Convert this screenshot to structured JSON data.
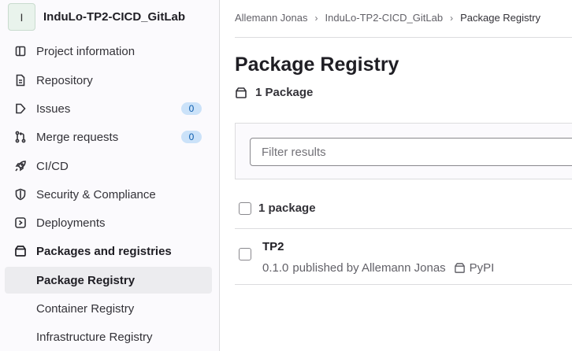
{
  "project": {
    "avatar_letter": "I",
    "name": "InduLo-TP2-CICD_GitLab"
  },
  "sidebar": {
    "items": [
      {
        "label": "Project information",
        "icon": "project-icon"
      },
      {
        "label": "Repository",
        "icon": "doc-icon"
      },
      {
        "label": "Issues",
        "icon": "issues-icon",
        "badge": "0"
      },
      {
        "label": "Merge requests",
        "icon": "git-merge-icon",
        "badge": "0"
      },
      {
        "label": "CI/CD",
        "icon": "rocket-icon"
      },
      {
        "label": "Security & Compliance",
        "icon": "shield-icon"
      },
      {
        "label": "Deployments",
        "icon": "deployments-icon"
      },
      {
        "label": "Packages and registries",
        "icon": "package-icon"
      },
      {
        "label": "Package Registry"
      },
      {
        "label": "Container Registry"
      },
      {
        "label": "Infrastructure Registry"
      }
    ]
  },
  "breadcrumb": {
    "user": "Allemann Jonas",
    "project": "InduLo-TP2-CICD_GitLab",
    "current": "Package Registry"
  },
  "page": {
    "title": "Package Registry",
    "package_count": "1 Package"
  },
  "filter": {
    "placeholder": "Filter results"
  },
  "list": {
    "header_count": "1 package",
    "packages": [
      {
        "name": "TP2",
        "version": "0.1.0",
        "published_text": "published by Allemann Jonas",
        "type": "PyPI"
      }
    ]
  },
  "colors": {
    "badge_bg": "#cbe2f9",
    "badge_text": "#0b5cad",
    "active_bg": "#ececef",
    "sidebar_bg": "#fbfafd"
  }
}
